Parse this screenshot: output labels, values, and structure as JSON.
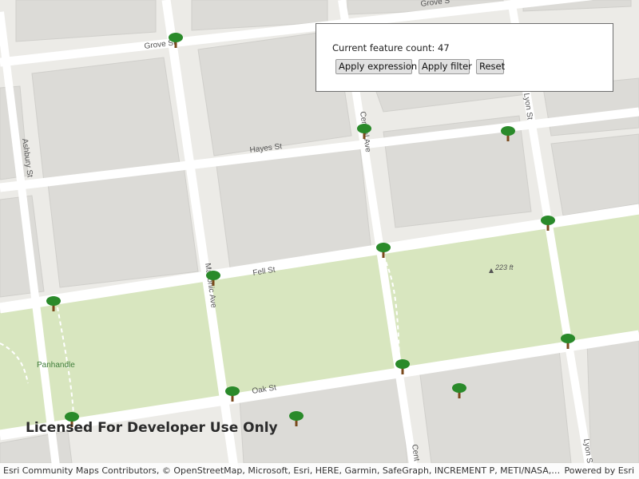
{
  "panel": {
    "count_label": "Current feature count:",
    "count_value": "47",
    "apply_expression_label": "Apply expression",
    "apply_filter_label": "Apply filter",
    "reset_label": "Reset"
  },
  "map": {
    "streets": {
      "grove_st": "Grove St",
      "grove_st_ne": "Grove S",
      "hayes_st": "Hayes St",
      "fell_st": "Fell St",
      "oak_st": "Oak St",
      "ashbury_st": "Ashbury St",
      "masonic_ave": "Masonic Ave",
      "central_ave": "Central Ave",
      "central_ave_bottom": "Cent",
      "lyon_st": "Lyon St",
      "lyon_st_bottom": "Lyon S"
    },
    "park_label": "Panhandle",
    "elevation_label": "223 ft",
    "colors": {
      "land": "#ecebe7",
      "park": "#d8e6bf",
      "road": "#ffffff",
      "building": "#dcdbd7",
      "tree_crown": "#2a8a2a",
      "tree_trunk": "#7a4a1c"
    },
    "tree_icon": "tree-icon"
  },
  "watermark": "Licensed For Developer Use Only",
  "attribution": {
    "text": "Esri Community Maps Contributors, © OpenStreetMap, Microsoft, Esri, HERE, Garmin, SafeGraph, INCREMENT P, METI/NASA, USGS, Bureau of Land Management, EPA, NPS, US Census Bureau, USDA, USFWS",
    "powered_by": "Powered by Esri"
  }
}
